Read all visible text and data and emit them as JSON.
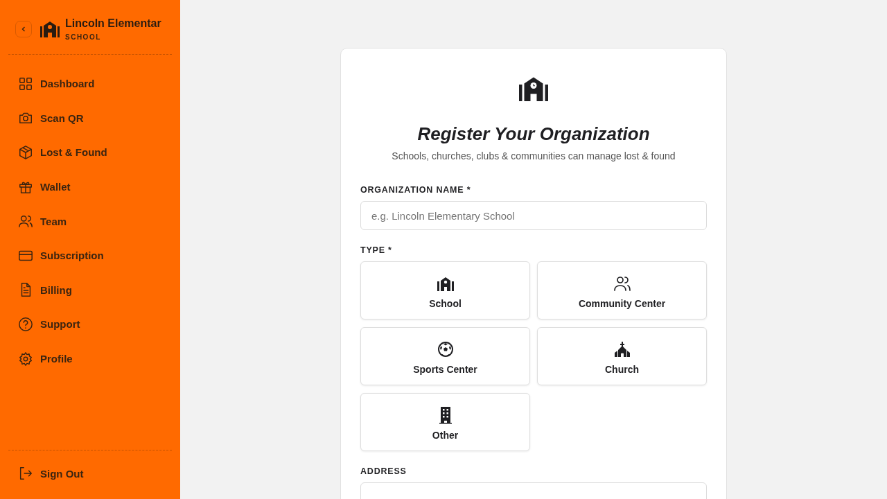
{
  "sidebar": {
    "org_name": "Lincoln Elementar",
    "org_type": "SCHOOL",
    "items": [
      {
        "label": "Dashboard",
        "kind": "grid"
      },
      {
        "label": "Scan QR",
        "kind": "camera"
      },
      {
        "label": "Lost & Found",
        "kind": "box"
      },
      {
        "label": "Wallet",
        "kind": "gift"
      },
      {
        "label": "Team",
        "kind": "users"
      },
      {
        "label": "Subscription",
        "kind": "card"
      },
      {
        "label": "Billing",
        "kind": "file"
      },
      {
        "label": "Support",
        "kind": "help"
      },
      {
        "label": "Profile",
        "kind": "gear"
      }
    ],
    "sign_out": "Sign Out"
  },
  "form": {
    "title": "Register Your Organization",
    "subtitle": "Schools, churches, clubs & communities can manage lost & found",
    "name_label": "ORGANIZATION NAME *",
    "name_placeholder": "e.g. Lincoln Elementary School",
    "type_label": "TYPE *",
    "types": [
      {
        "label": "School",
        "kind": "school"
      },
      {
        "label": "Community Center",
        "kind": "users"
      },
      {
        "label": "Sports Center",
        "kind": "ball"
      },
      {
        "label": "Church",
        "kind": "church"
      },
      {
        "label": "Other",
        "kind": "building"
      }
    ],
    "address_label": "ADDRESS"
  }
}
